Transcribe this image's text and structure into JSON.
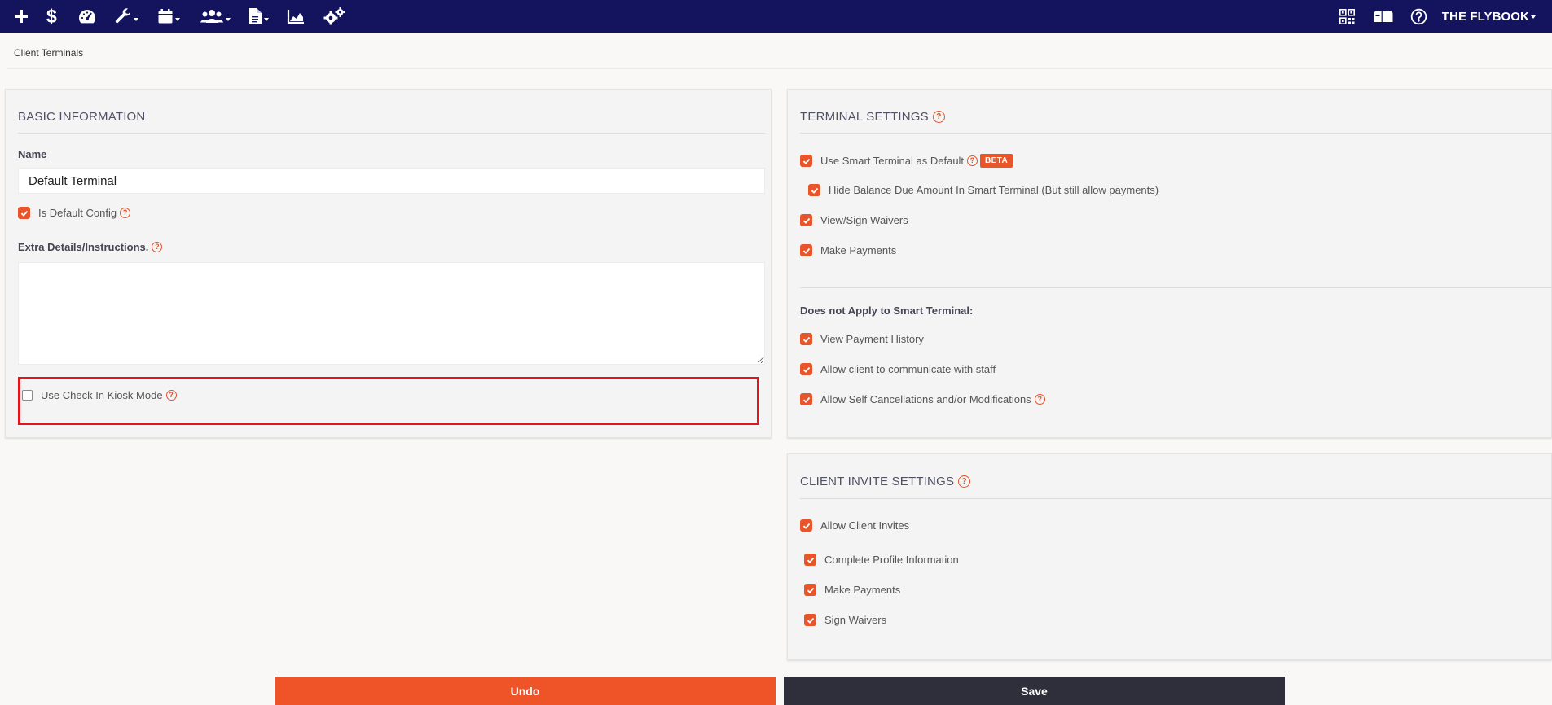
{
  "nav": {
    "brand": "THE FLYBOOK",
    "icons": [
      "plus-icon",
      "dollar-icon",
      "dashboard-icon",
      "wrench-icon",
      "calendar-icon",
      "users-icon",
      "document-icon",
      "chart-icon",
      "gears-icon",
      "qr-code-icon",
      "mailbox-icon",
      "help-icon"
    ]
  },
  "breadcrumb": "Client Terminals",
  "basic": {
    "title": "BASIC INFORMATION",
    "name_label": "Name",
    "name_value": "Default Terminal",
    "is_default_label": "Is Default Config",
    "is_default_checked": true,
    "extra_label": "Extra Details/Instructions.",
    "extra_value": "",
    "kiosk_label": "Use Check In Kiosk Mode",
    "kiosk_checked": false
  },
  "terminal": {
    "title": "TERMINAL SETTINGS",
    "smart_default_label": "Use Smart Terminal as Default",
    "beta_badge": "BETA",
    "hide_balance_label": "Hide Balance Due Amount In Smart Terminal (But still allow payments)",
    "view_sign_label": "View/Sign Waivers",
    "make_payments_label": "Make Payments",
    "not_apply_label": "Does not Apply to Smart Terminal:",
    "view_history_label": "View Payment History",
    "communicate_label": "Allow client to communicate with staff",
    "self_cancel_label": "Allow Self Cancellations and/or Modifications"
  },
  "invite": {
    "title": "CLIENT INVITE SETTINGS",
    "allow_invites_label": "Allow Client Invites",
    "complete_profile_label": "Complete Profile Information",
    "make_payments_label": "Make Payments",
    "sign_waivers_label": "Sign Waivers"
  },
  "actions": {
    "undo_label": "Undo",
    "save_label": "Save"
  },
  "colors": {
    "nav_bg": "#13135e",
    "accent": "#e9552b",
    "highlight": "#e3141a",
    "save_bg": "#2e2f3a"
  }
}
